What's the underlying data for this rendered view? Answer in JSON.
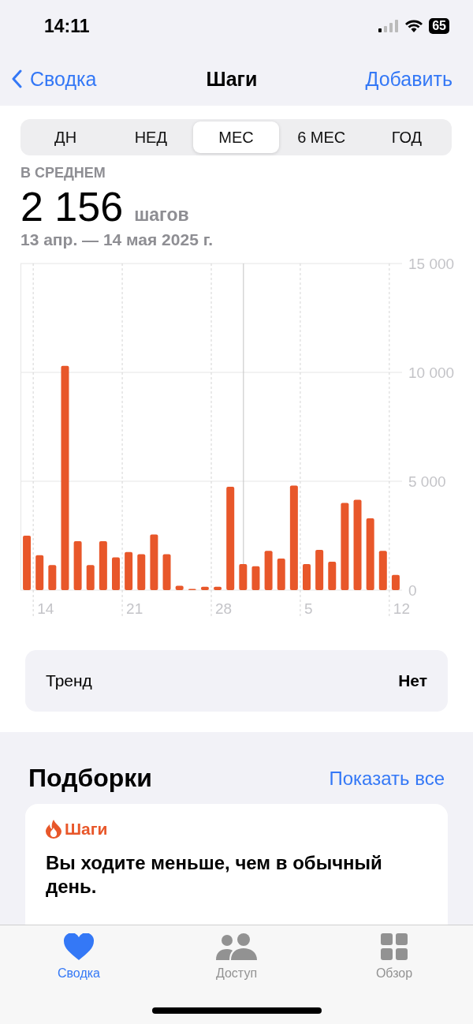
{
  "status_bar": {
    "time": "14:11",
    "battery": "65"
  },
  "nav": {
    "back": "Сводка",
    "title": "Шаги",
    "action": "Добавить"
  },
  "segments": [
    {
      "label": "ДН",
      "selected": false
    },
    {
      "label": "НЕД",
      "selected": false
    },
    {
      "label": "МЕС",
      "selected": true
    },
    {
      "label": "6 МЕС",
      "selected": false
    },
    {
      "label": "ГОД",
      "selected": false
    }
  ],
  "summary": {
    "label": "В СРЕДНЕМ",
    "value": "2 156",
    "unit": "шагов",
    "range": "13 апр. — 14 мая 2025 г."
  },
  "chart_data": {
    "type": "bar",
    "grid": true,
    "categories": [
      null,
      "14",
      null,
      null,
      null,
      null,
      null,
      null,
      "21",
      null,
      null,
      null,
      null,
      null,
      null,
      "28",
      null,
      null,
      null,
      null,
      null,
      null,
      "5",
      null,
      null,
      null,
      null,
      null,
      null,
      "12"
    ],
    "series": [
      {
        "color": "#e8572a",
        "values": [
          2500,
          1600,
          1150,
          10300,
          2250,
          1150,
          2250,
          1500,
          1750,
          1650,
          2550,
          1650,
          200,
          30,
          150,
          150,
          4750,
          1200,
          1100,
          1800,
          1450,
          4800,
          1200,
          1850,
          1300,
          4000,
          4150,
          3300,
          1800,
          700
        ]
      }
    ],
    "ylim": [
      0,
      15000
    ],
    "yticks": [
      {
        "value": 0,
        "label": "0"
      },
      {
        "value": 5000,
        "label": "5 000"
      },
      {
        "value": 10000,
        "label": "10 000"
      },
      {
        "value": 15000,
        "label": "15 000"
      }
    ]
  },
  "trend": {
    "label": "Тренд",
    "value": "Нет"
  },
  "highlights": {
    "title": "Подборки",
    "link": "Показать все",
    "card": {
      "category": "Шаги",
      "text": "Вы ходите меньше, чем в обычный день."
    }
  },
  "tab_bar": [
    {
      "label": "Сводка",
      "kind": "heart",
      "selected": true
    },
    {
      "label": "Доступ",
      "kind": "people",
      "selected": false
    },
    {
      "label": "Обзор",
      "kind": "grid",
      "selected": false
    }
  ]
}
